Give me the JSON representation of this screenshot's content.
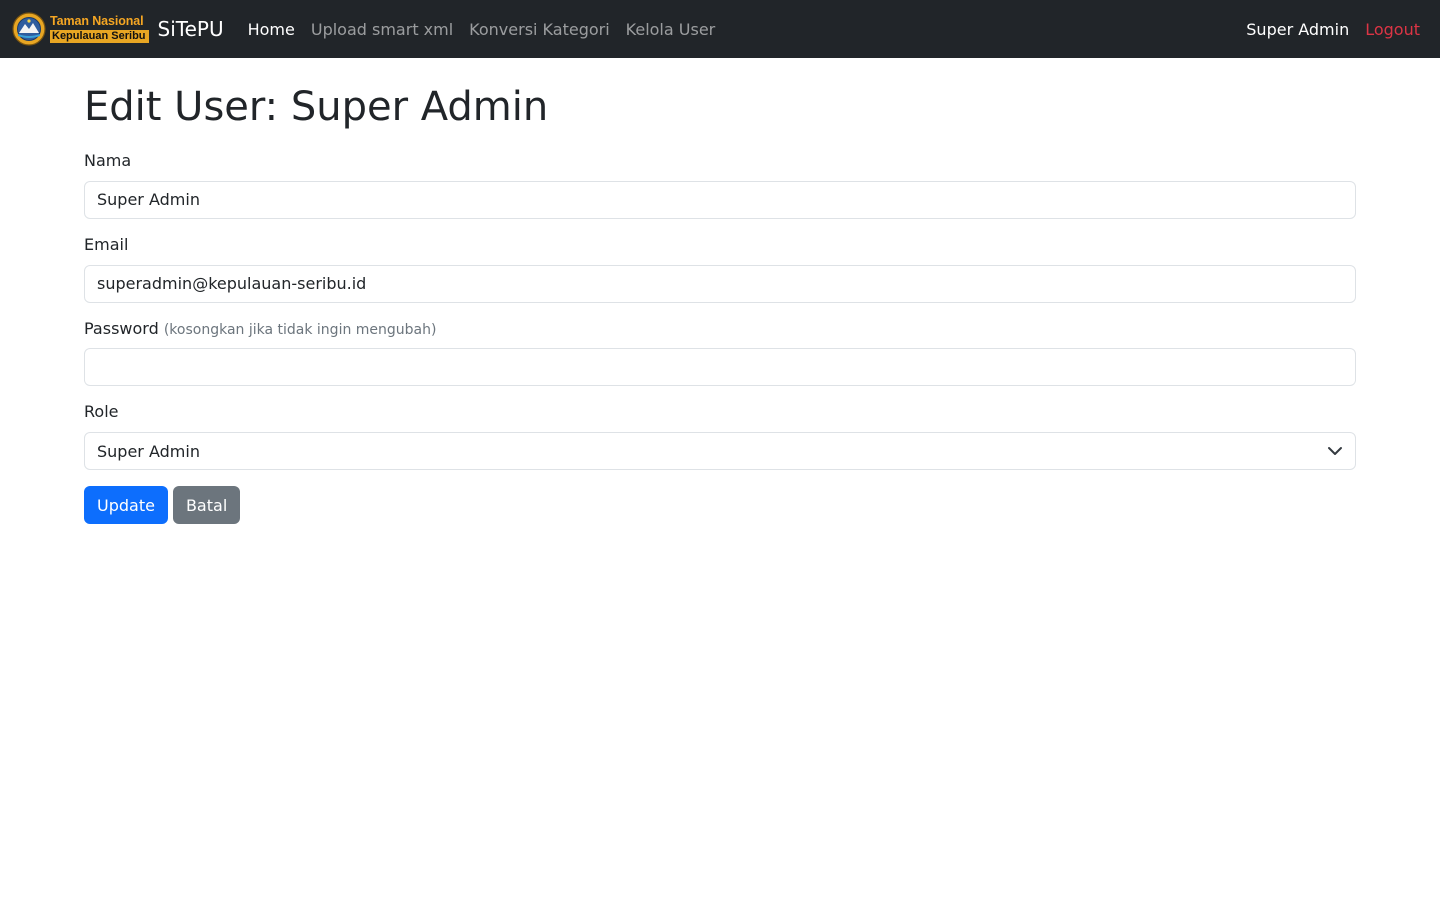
{
  "navbar": {
    "logo": {
      "line1": "Taman Nasional",
      "line2": "Kepulauan Seribu",
      "icon": "park-emblem-icon"
    },
    "brand": "SiTePU",
    "links": [
      {
        "label": "Home",
        "active": true
      },
      {
        "label": "Upload smart xml",
        "active": false
      },
      {
        "label": "Konversi Kategori",
        "active": false
      },
      {
        "label": "Kelola User",
        "active": false
      }
    ],
    "user_name": "Super Admin",
    "logout_label": "Logout"
  },
  "page": {
    "title": "Edit User: Super Admin"
  },
  "form": {
    "nama": {
      "label": "Nama",
      "value": "Super Admin"
    },
    "email": {
      "label": "Email",
      "value": "superadmin@kepulauan-seribu.id"
    },
    "password": {
      "label": "Password",
      "hint": "(kosongkan jika tidak ingin mengubah)",
      "value": ""
    },
    "role": {
      "label": "Role",
      "selected": "Super Admin"
    },
    "update_label": "Update",
    "cancel_label": "Batal"
  },
  "colors": {
    "navbar_bg": "#212529",
    "primary": "#0d6efd",
    "secondary": "#6c757d",
    "danger": "#dc3545"
  }
}
